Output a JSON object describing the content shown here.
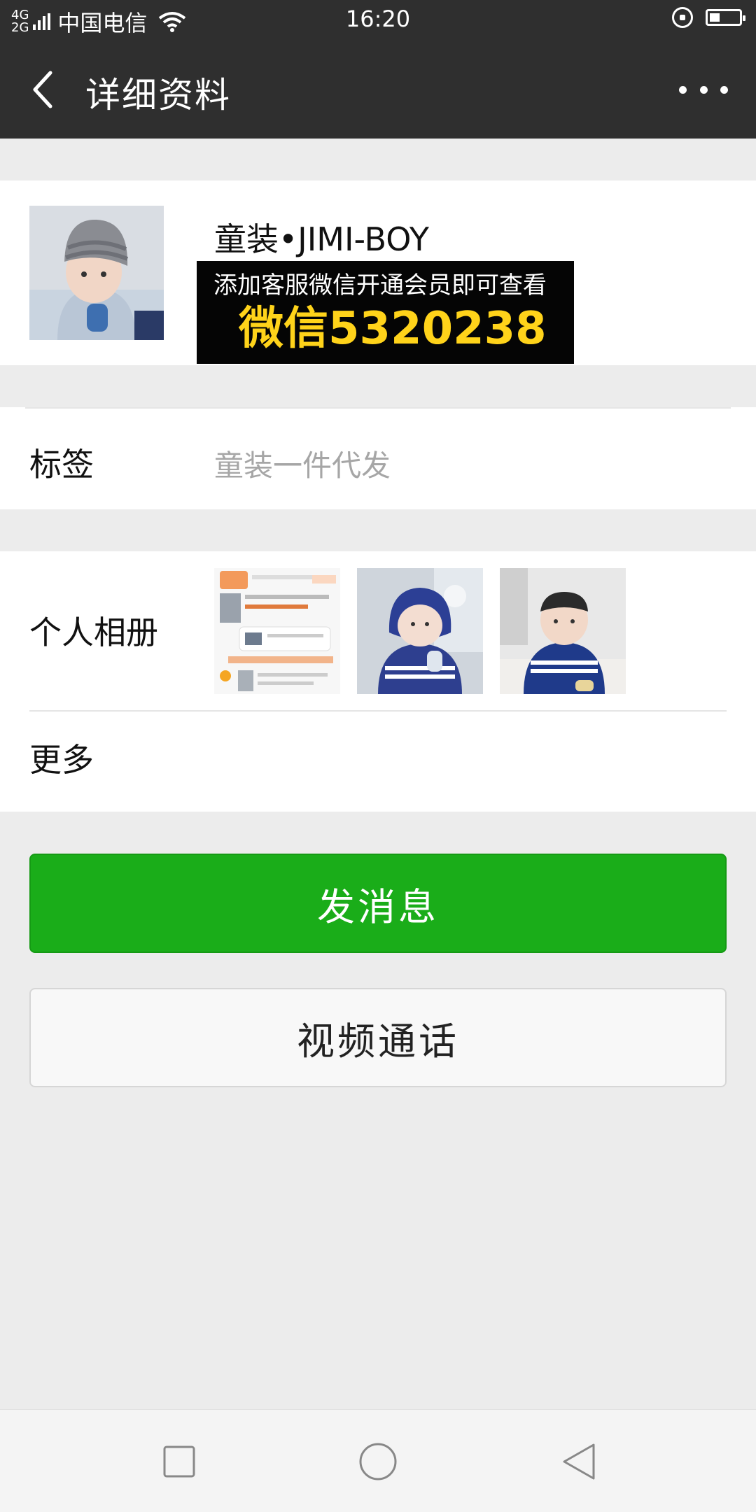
{
  "status_bar": {
    "network_top": "4G",
    "network_bottom": "2G",
    "carrier": "中国电信",
    "time": "16:20",
    "battery_level": 0.35
  },
  "header": {
    "title": "详细资料",
    "back_icon": "chevron-left-icon",
    "more_icon": "more-dots-icon"
  },
  "profile": {
    "nickname": "童装•JIMI-BOY",
    "banner_line1": "添加客服微信开通会员即可查看",
    "banner_line2": "微信5320238"
  },
  "tags": {
    "label": "标签",
    "value": "童装一件代发"
  },
  "album": {
    "label": "个人相册"
  },
  "more": {
    "label": "更多"
  },
  "actions": {
    "send_message": "发消息",
    "video_call": "视频通话"
  },
  "colors": {
    "header_bg": "#2f2f2f",
    "primary_green": "#1aad19",
    "page_bg": "#ececec",
    "banner_bg": "#050505",
    "banner_text_yellow": "#ffd31a"
  },
  "nav_bar": {
    "icons": [
      "square-recents-icon",
      "circle-home-icon",
      "triangle-back-icon"
    ]
  }
}
